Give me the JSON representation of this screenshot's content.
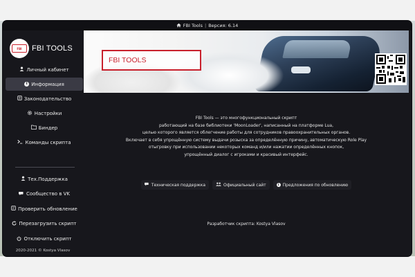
{
  "window": {
    "title": "FBI Tools",
    "version_label": "Версия: 6.14",
    "title_icon": "home-icon"
  },
  "logo": {
    "text": "FBI TOOLS"
  },
  "sidebar": {
    "items": [
      {
        "label": "Личный кабинет",
        "icon": "user-icon",
        "active": false
      },
      {
        "label": "Информация",
        "icon": "info-icon",
        "active": true
      },
      {
        "label": "Законодательство",
        "icon": "book-icon",
        "active": false
      },
      {
        "label": "Настройки",
        "icon": "gear-icon",
        "active": false
      },
      {
        "label": "Биндер",
        "icon": "folder-icon",
        "active": false
      },
      {
        "label": "Команды скрипта",
        "icon": "terminal-icon",
        "active": false
      }
    ],
    "items2": [
      {
        "label": "Тех.Поддержка",
        "icon": "support-icon"
      },
      {
        "label": "Сообщество в VK",
        "icon": "chat-icon"
      },
      {
        "label": "Проверить обновление",
        "icon": "update-icon"
      },
      {
        "label": "Перезагрузить скрипт",
        "icon": "reload-icon"
      },
      {
        "label": "Отключить скрипт",
        "icon": "power-icon"
      }
    ],
    "copyright": "2020-2021 © Kostya Vlasov"
  },
  "banner": {
    "title": "FBI TOOLS"
  },
  "description": {
    "lines": [
      "FBI Tools — это многофункциональный скрипт",
      "работающий на базе библиотеки 'MoonLoader', написанный на платформе Lua,",
      "целью которого является облегчение работы для сотрудников правоохранительных органов.",
      "Включает в себя упрощённую систему выдачи розыска за определённую причину, автоматическую Role Play",
      "отыгровку при использовании некоторых команд и/или нажатии определённых кнопок,",
      "упрощённый диалог с игроками и красивый интерфейс."
    ]
  },
  "links": [
    {
      "label": "Техническая поддержка",
      "icon": "chat-icon"
    },
    {
      "label": "Официальный сайт",
      "icon": "users-icon"
    },
    {
      "label": "Предложения по обновлению",
      "icon": "info-icon"
    }
  ],
  "developer": "Разработчик скрипта: Kostya Vlasov"
}
